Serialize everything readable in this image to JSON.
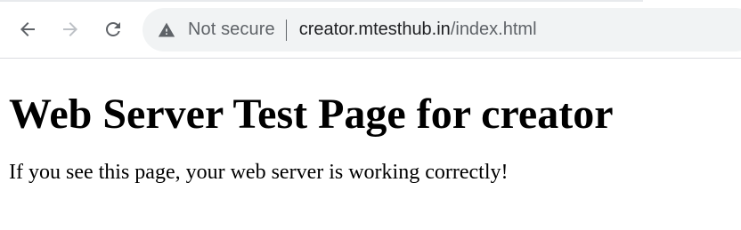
{
  "browser": {
    "security_label": "Not secure",
    "url_host": "creator.mtesthub.in",
    "url_path": "/index.html",
    "icons": {
      "back": "back-arrow-icon",
      "forward": "forward-arrow-icon",
      "reload": "reload-icon",
      "security": "warning-triangle-icon"
    },
    "colors": {
      "icon_active": "#5f6368",
      "icon_disabled": "#bdc1c6",
      "omnibox_bg": "#f1f3f4"
    }
  },
  "page": {
    "heading": "Web Server Test Page for creator",
    "paragraph": "If you see this page, your web server is working correctly!"
  }
}
